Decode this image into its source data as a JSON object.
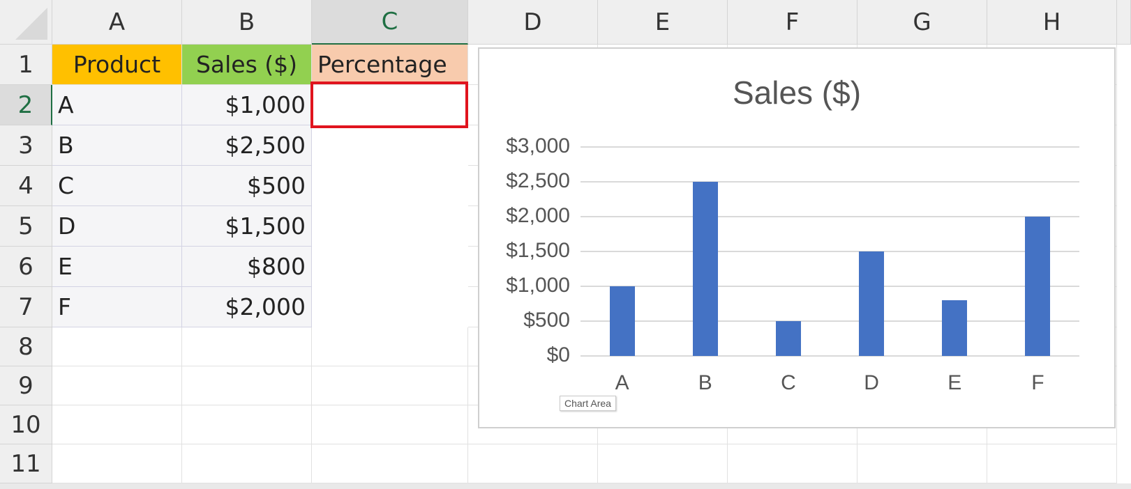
{
  "columns": [
    "A",
    "B",
    "C",
    "D",
    "E",
    "F",
    "G",
    "H"
  ],
  "rows": [
    "1",
    "2",
    "3",
    "4",
    "5",
    "6",
    "7",
    "8",
    "9",
    "10",
    "11"
  ],
  "table": {
    "headers": [
      "Product",
      "Sales ($)",
      "Percentage"
    ],
    "rows": [
      {
        "product": "A",
        "sales": "$1,000"
      },
      {
        "product": "B",
        "sales": "$2,500"
      },
      {
        "product": "C",
        "sales": "$500"
      },
      {
        "product": "D",
        "sales": "$1,500"
      },
      {
        "product": "E",
        "sales": "$800"
      },
      {
        "product": "F",
        "sales": "$2,000"
      }
    ]
  },
  "selection": {
    "cell": "C2"
  },
  "colors": {
    "header_a": "#ffc000",
    "header_b": "#92d050",
    "header_c": "#f8cbad",
    "bar": "#4472c4",
    "selection": "#e0141e"
  },
  "chart_data": {
    "type": "bar",
    "title": "Sales ($)",
    "categories": [
      "A",
      "B",
      "C",
      "D",
      "E",
      "F"
    ],
    "values": [
      1000,
      2500,
      500,
      1500,
      800,
      2000
    ],
    "ylim": [
      0,
      3000
    ],
    "yticks": [
      "$0",
      "$500",
      "$1,000",
      "$1,500",
      "$2,000",
      "$2,500",
      "$3,000"
    ],
    "grid": true
  },
  "tooltip": "Chart Area"
}
